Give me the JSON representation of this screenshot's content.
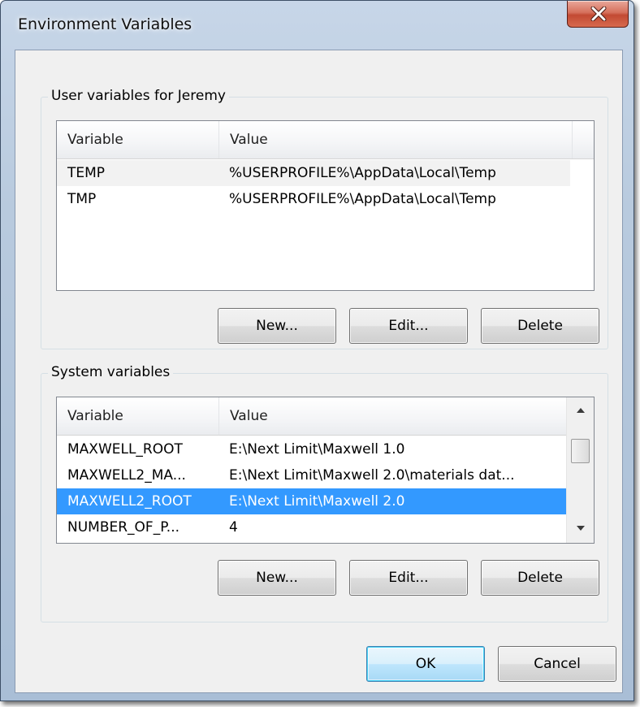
{
  "window": {
    "title": "Environment Variables"
  },
  "user_vars": {
    "legend": "User variables for Jeremy",
    "columns": [
      "Variable",
      "Value"
    ],
    "rows": [
      {
        "variable": "TEMP",
        "value": "%USERPROFILE%\\AppData\\Local\\Temp"
      },
      {
        "variable": "TMP",
        "value": "%USERPROFILE%\\AppData\\Local\\Temp"
      }
    ],
    "buttons": {
      "new": "New...",
      "edit": "Edit...",
      "delete": "Delete"
    }
  },
  "system_vars": {
    "legend": "System variables",
    "columns": [
      "Variable",
      "Value"
    ],
    "rows": [
      {
        "variable": "MAXWELL_ROOT",
        "value": "E:\\Next Limit\\Maxwell 1.0"
      },
      {
        "variable": "MAXWELL2_MA...",
        "value": "E:\\Next Limit\\Maxwell 2.0\\materials dat..."
      },
      {
        "variable": "MAXWELL2_ROOT",
        "value": "E:\\Next Limit\\Maxwell 2.0",
        "selected": true
      },
      {
        "variable": "NUMBER_OF_P...",
        "value": "4"
      }
    ],
    "buttons": {
      "new": "New...",
      "edit": "Edit...",
      "delete": "Delete"
    }
  },
  "footer": {
    "ok": "OK",
    "cancel": "Cancel"
  },
  "colors": {
    "selection": "#3399ff",
    "close_button": "#c24a33"
  }
}
